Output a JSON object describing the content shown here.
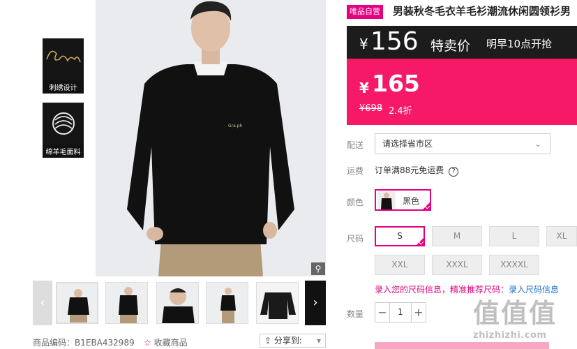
{
  "gallery": {
    "features": [
      {
        "label": "刺绣设计",
        "icon": "embroidery-icon"
      },
      {
        "label": "绵羊毛面料",
        "icon": "wool-icon"
      }
    ],
    "zoom_icon": "magnifier-icon",
    "thumb_prev": "‹",
    "thumb_next": "›"
  },
  "product_code_label": "商品编码：",
  "product_code": "B1EBA432989",
  "favorite_label": "收藏商品",
  "share_label": "分享到:",
  "product": {
    "badge": "唯品自营",
    "title": "男装秋冬毛衣羊毛衫潮流休闲圆领衫男"
  },
  "flash_sale": {
    "currency": "¥",
    "price": "156",
    "label": "特卖价",
    "notice": "明早10点开抢"
  },
  "price": {
    "currency": "¥",
    "current": "165",
    "original": "¥698",
    "discount": "2.4折"
  },
  "delivery": {
    "label": "配送",
    "placeholder": "请选择省市区"
  },
  "shipping": {
    "label": "运费",
    "text": "订单满88元免运费",
    "help": "?"
  },
  "color": {
    "label": "颜色",
    "selected": "黑色"
  },
  "size": {
    "label": "尺码",
    "options": [
      "S",
      "M",
      "L",
      "XL",
      "XXL",
      "XXXL",
      "XXXXL"
    ],
    "selected": "S",
    "hint": "录入您的尺码信息，精准推荐尺码：",
    "hint_link": "录入尺码信息"
  },
  "quantity": {
    "label": "数量",
    "value": "1",
    "minus": "−",
    "plus": "+"
  },
  "watermark": {
    "cn": "值值值",
    "en": "zhizhizhi.com"
  },
  "colors": {
    "accent": "#e4007f",
    "price_bg": "#f51968",
    "flash_bg": "#1c1c1c"
  }
}
